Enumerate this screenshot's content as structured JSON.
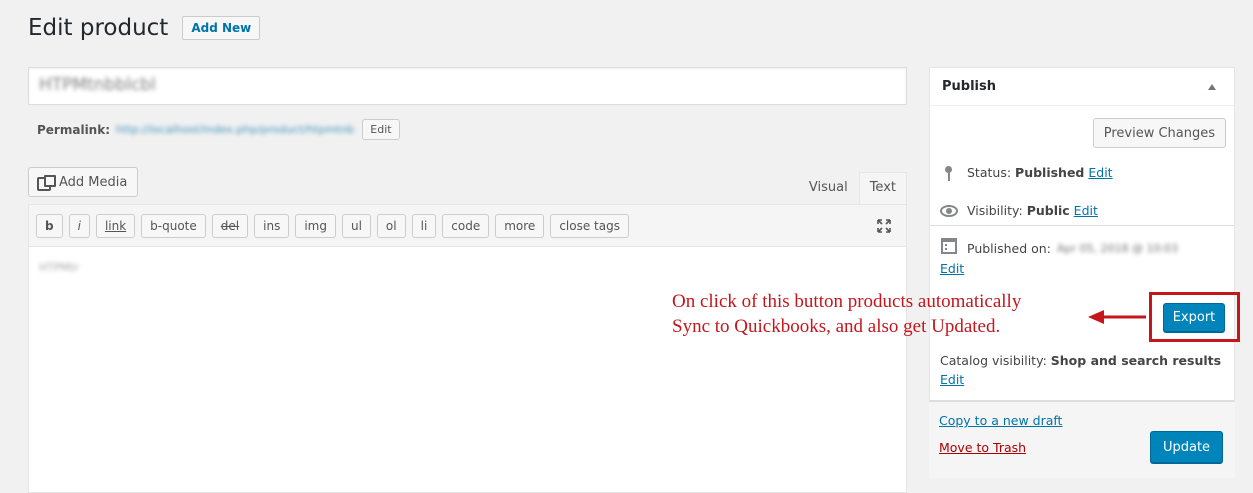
{
  "header": {
    "title": "Edit product",
    "add_new_label": "Add New"
  },
  "post": {
    "title_value": "HTPMtnbblcbl",
    "permalink_label": "Permalink:",
    "permalink_url": "http://localhost/index.php/product/htpmtnb",
    "permalink_edit_label": "Edit"
  },
  "editor": {
    "add_media_label": "Add Media",
    "tabs": [
      "Visual",
      "Text"
    ],
    "active_tab": "Text",
    "quicktags": [
      "b",
      "i",
      "link",
      "b-quote",
      "del",
      "ins",
      "img",
      "ul",
      "ol",
      "li",
      "code",
      "more",
      "close tags"
    ],
    "content": "HTPMtr"
  },
  "publish": {
    "title": "Publish",
    "preview_label": "Preview Changes",
    "status_label": "Status:",
    "status_value": "Published",
    "visibility_label": "Visibility:",
    "visibility_value": "Public",
    "published_on_label": "Published on:",
    "published_on_value": "Apr 05, 2018 @ 10:03",
    "edit_label": "Edit",
    "export_label": "Export",
    "catalog_visibility_label": "Catalog visibility:",
    "catalog_visibility_value": "Shop and search results",
    "copy_draft_label": "Copy to a new draft",
    "trash_label": "Move to Trash",
    "update_label": "Update"
  },
  "annotation": {
    "line1": "On click of this button products automatically",
    "line2": "Sync to Quickbooks, and also get Updated."
  },
  "colors": {
    "primary_button": "#0085ba",
    "link": "#0073aa",
    "trash_link": "#a00",
    "annotation": "#c4161c"
  },
  "icons": {
    "add_media": "media-icon",
    "status": "pin-icon",
    "visibility": "eye-icon",
    "published_on": "calendar-icon",
    "fullscreen": "fullscreen-icon",
    "toggle": "arrow-up-icon"
  }
}
